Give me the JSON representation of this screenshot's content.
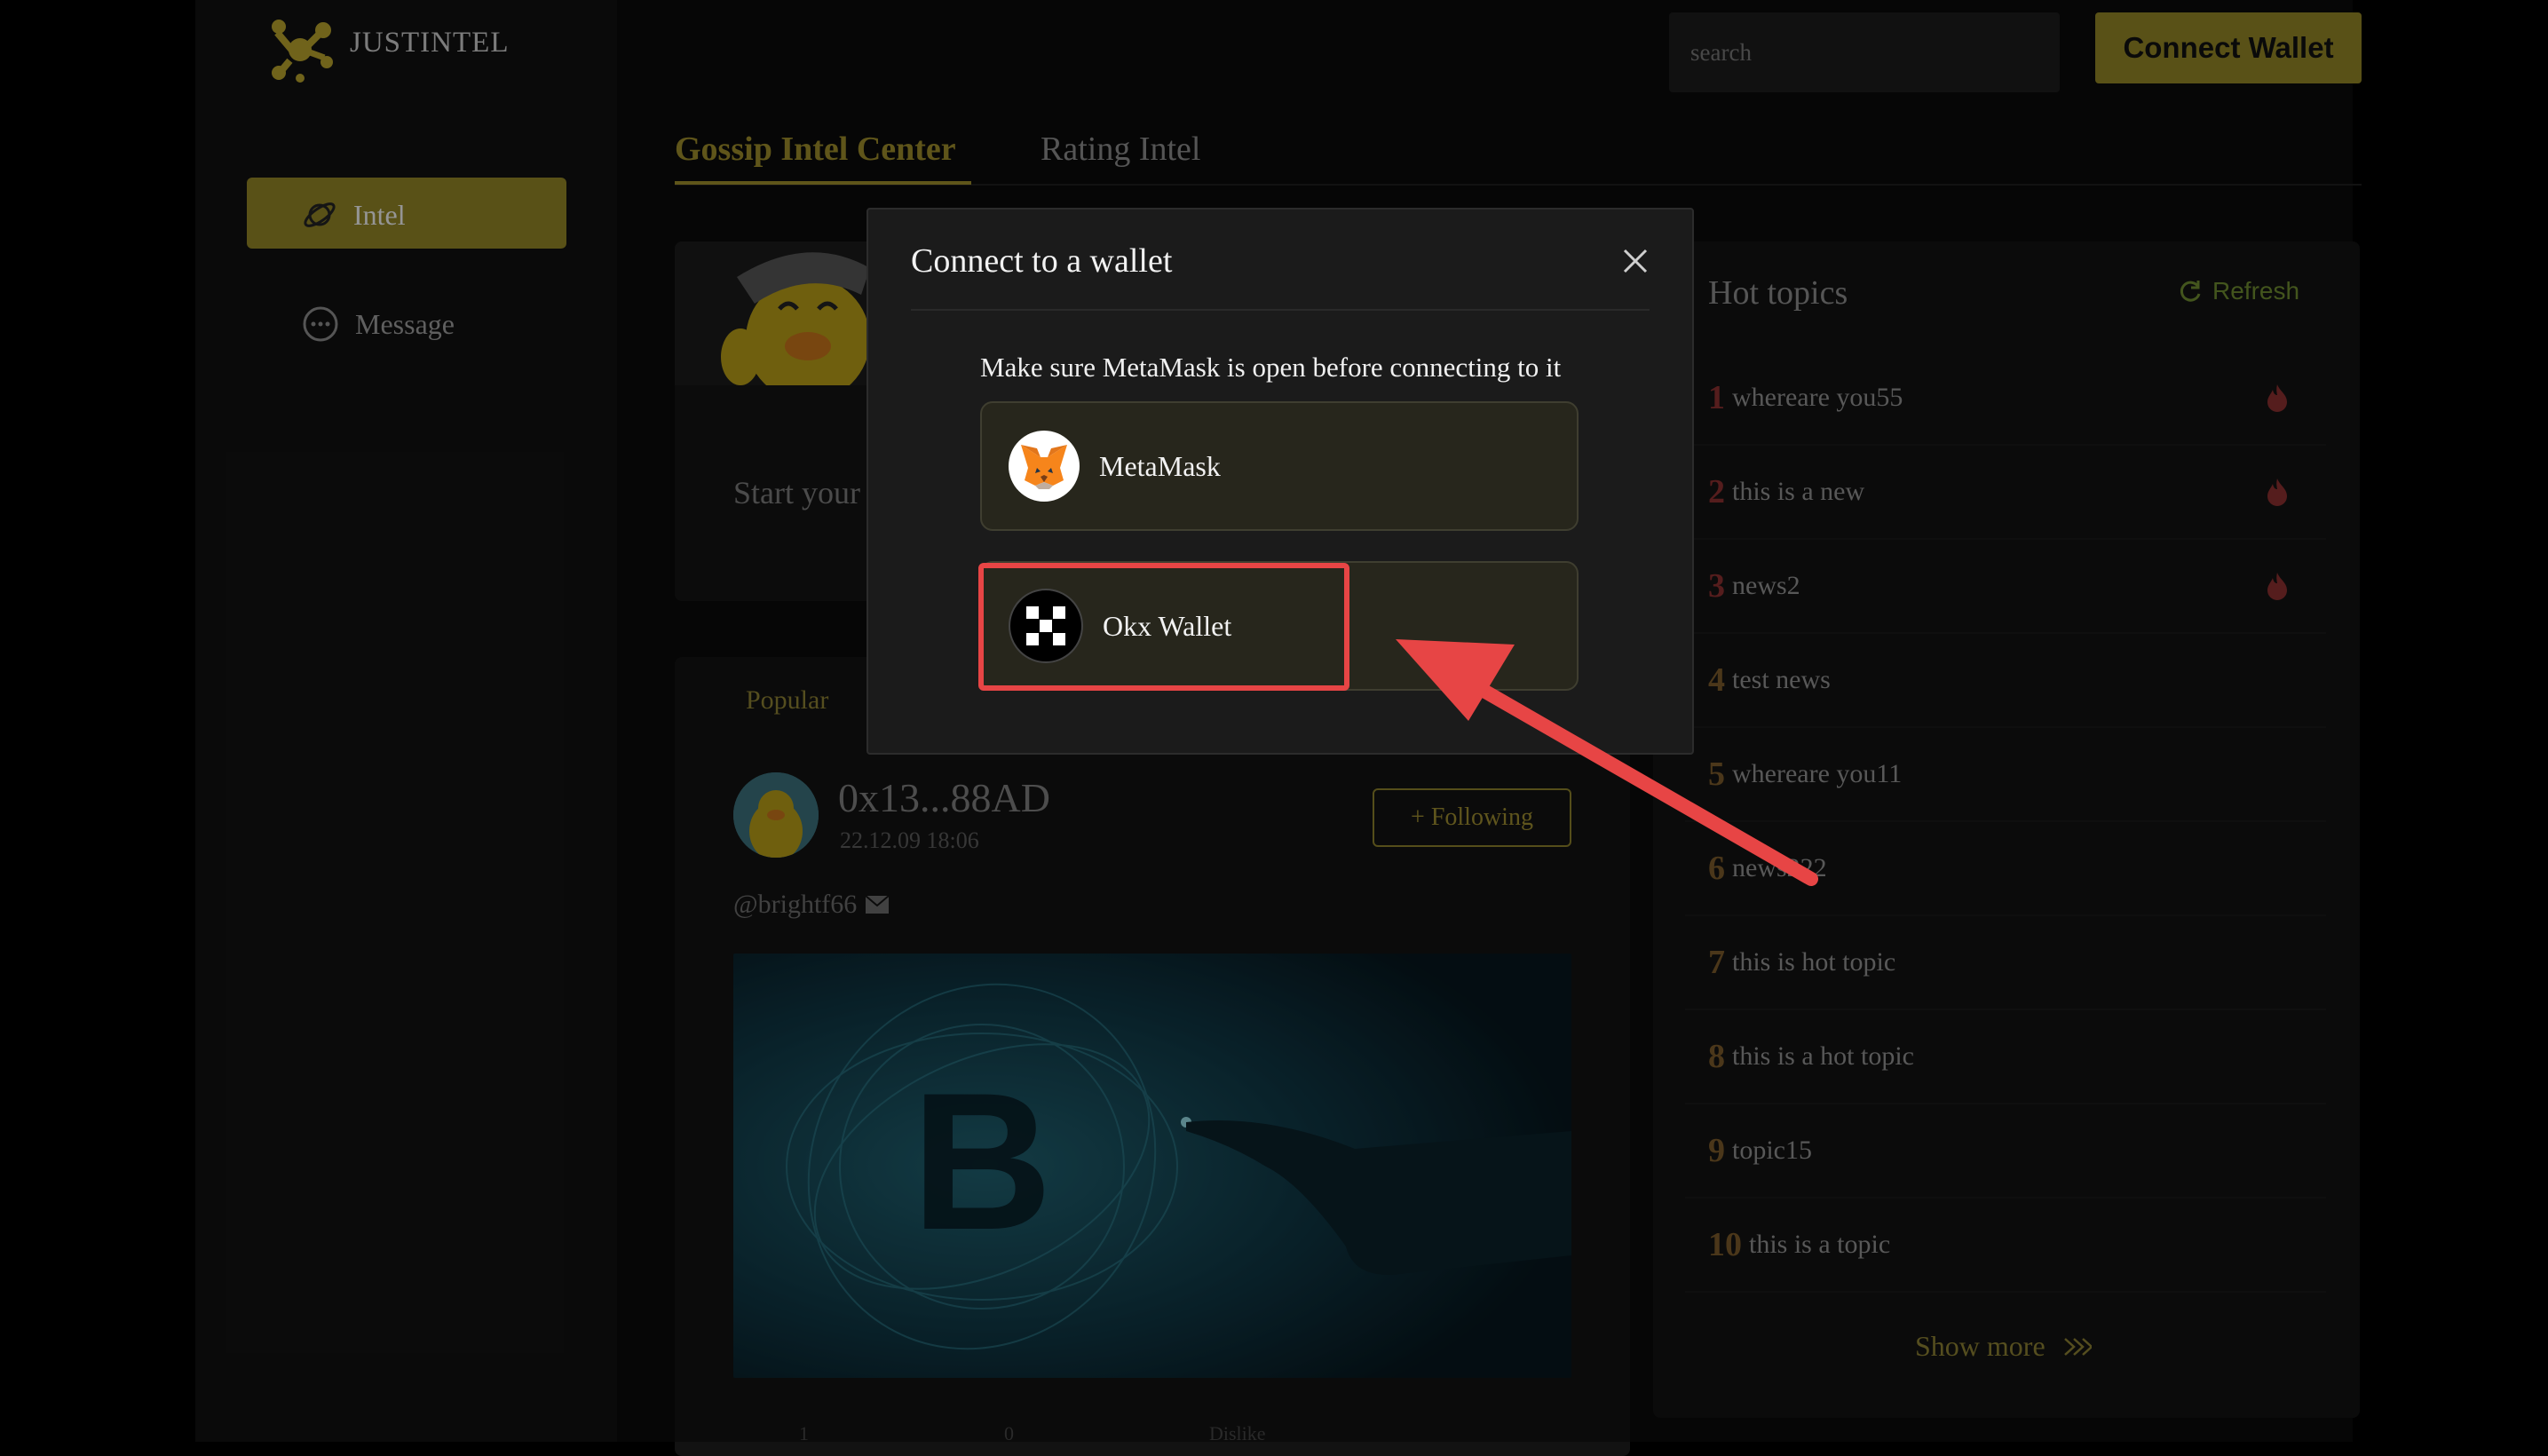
{
  "brand": {
    "name": "JUSTINTEL"
  },
  "sidebar": {
    "items": [
      {
        "label": "Intel",
        "active": true,
        "icon": "planet-icon"
      },
      {
        "label": "Message",
        "active": false,
        "icon": "chat-bubble-icon"
      }
    ]
  },
  "header": {
    "search_placeholder": "search",
    "connect_label": "Connect Wallet"
  },
  "tabs": [
    {
      "label": "Gossip Intel Center",
      "active": true
    },
    {
      "label": "Rating Intel",
      "active": false
    }
  ],
  "compose": {
    "placeholder": "Start your"
  },
  "feed": {
    "filter_label": "Popular",
    "post": {
      "author": "0x13...88AD",
      "date": "22.12.09 18:06",
      "follow_label": "+ Following",
      "handle": "@brightf66",
      "actions": [
        "1",
        "0",
        "Dislike"
      ]
    }
  },
  "hot_topics": {
    "title": "Hot topics",
    "refresh_label": "Refresh",
    "items": [
      {
        "rank": "1",
        "text": "whereare you55",
        "hot": true
      },
      {
        "rank": "2",
        "text": "this is a new",
        "hot": true
      },
      {
        "rank": "3",
        "text": "news2",
        "hot": true
      },
      {
        "rank": "4",
        "text": "test news",
        "hot": false
      },
      {
        "rank": "5",
        "text": "whereare you11",
        "hot": false
      },
      {
        "rank": "6",
        "text": "news222",
        "hot": false
      },
      {
        "rank": "7",
        "text": "this is hot topic",
        "hot": false
      },
      {
        "rank": "8",
        "text": "this is a hot topic",
        "hot": false
      },
      {
        "rank": "9",
        "text": "topic15",
        "hot": false
      },
      {
        "rank": "10",
        "text": "this is a topic",
        "hot": false
      }
    ],
    "show_more": "Show more"
  },
  "modal": {
    "title": "Connect to a wallet",
    "hint": "Make sure MetaMask is open before connecting to it",
    "wallets": [
      {
        "label": "MetaMask",
        "icon": "metamask-fox-icon"
      },
      {
        "label": "Okx Wallet",
        "icon": "okx-icon"
      }
    ]
  },
  "colors": {
    "accent": "#908426",
    "highlight": "#e74545",
    "hot_rank": "#8a2f2f"
  }
}
